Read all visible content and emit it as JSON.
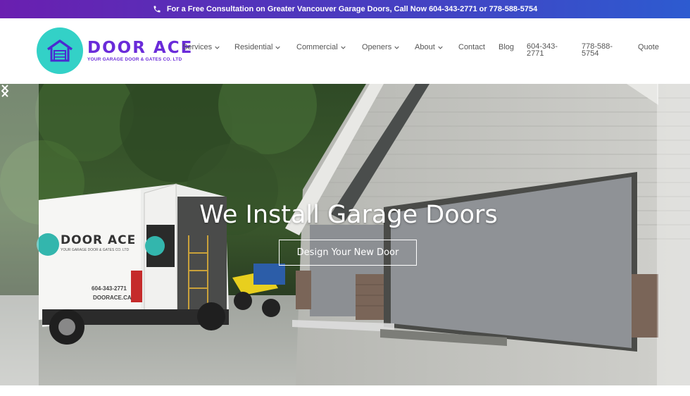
{
  "topbar": {
    "text": "For a Free Consultation on Greater Vancouver Garage Doors, Call Now 604-343-2771 or 778-588-5754",
    "icon": "phone-icon",
    "gradient_start": "#6a1fb0",
    "gradient_end": "#2d5bd0"
  },
  "logo": {
    "name": "DOOR ACE",
    "tagline": "YOUR GARAGE DOOR & GATES CO. LTD",
    "circle_color": "#33d1c7",
    "text_color": "#6a2bd9",
    "icon": "garage-house-icon"
  },
  "nav": {
    "items": [
      {
        "label": "Services",
        "dropdown": true
      },
      {
        "label": "Residential",
        "dropdown": true
      },
      {
        "label": "Commercial",
        "dropdown": true
      },
      {
        "label": "Openers",
        "dropdown": true
      },
      {
        "label": "About",
        "dropdown": true
      },
      {
        "label": "Contact",
        "dropdown": false
      },
      {
        "label": "Blog",
        "dropdown": false
      },
      {
        "label": "604-343-2771",
        "dropdown": false
      },
      {
        "label": "778-588-5754",
        "dropdown": false
      },
      {
        "label": "Quote",
        "dropdown": false
      }
    ]
  },
  "hero": {
    "title": "We Install Garage Doors",
    "button_label": "Design Your New Door",
    "van_brand": "DOOR ACE",
    "van_tagline": "YOUR GARAGE DOOR & GATES CO. LTD",
    "van_phone": "604-343-2771",
    "van_site": "DOORACE.CA",
    "prev_icon": "chevron-left-icon",
    "next_icon": "chevron-right-icon"
  }
}
